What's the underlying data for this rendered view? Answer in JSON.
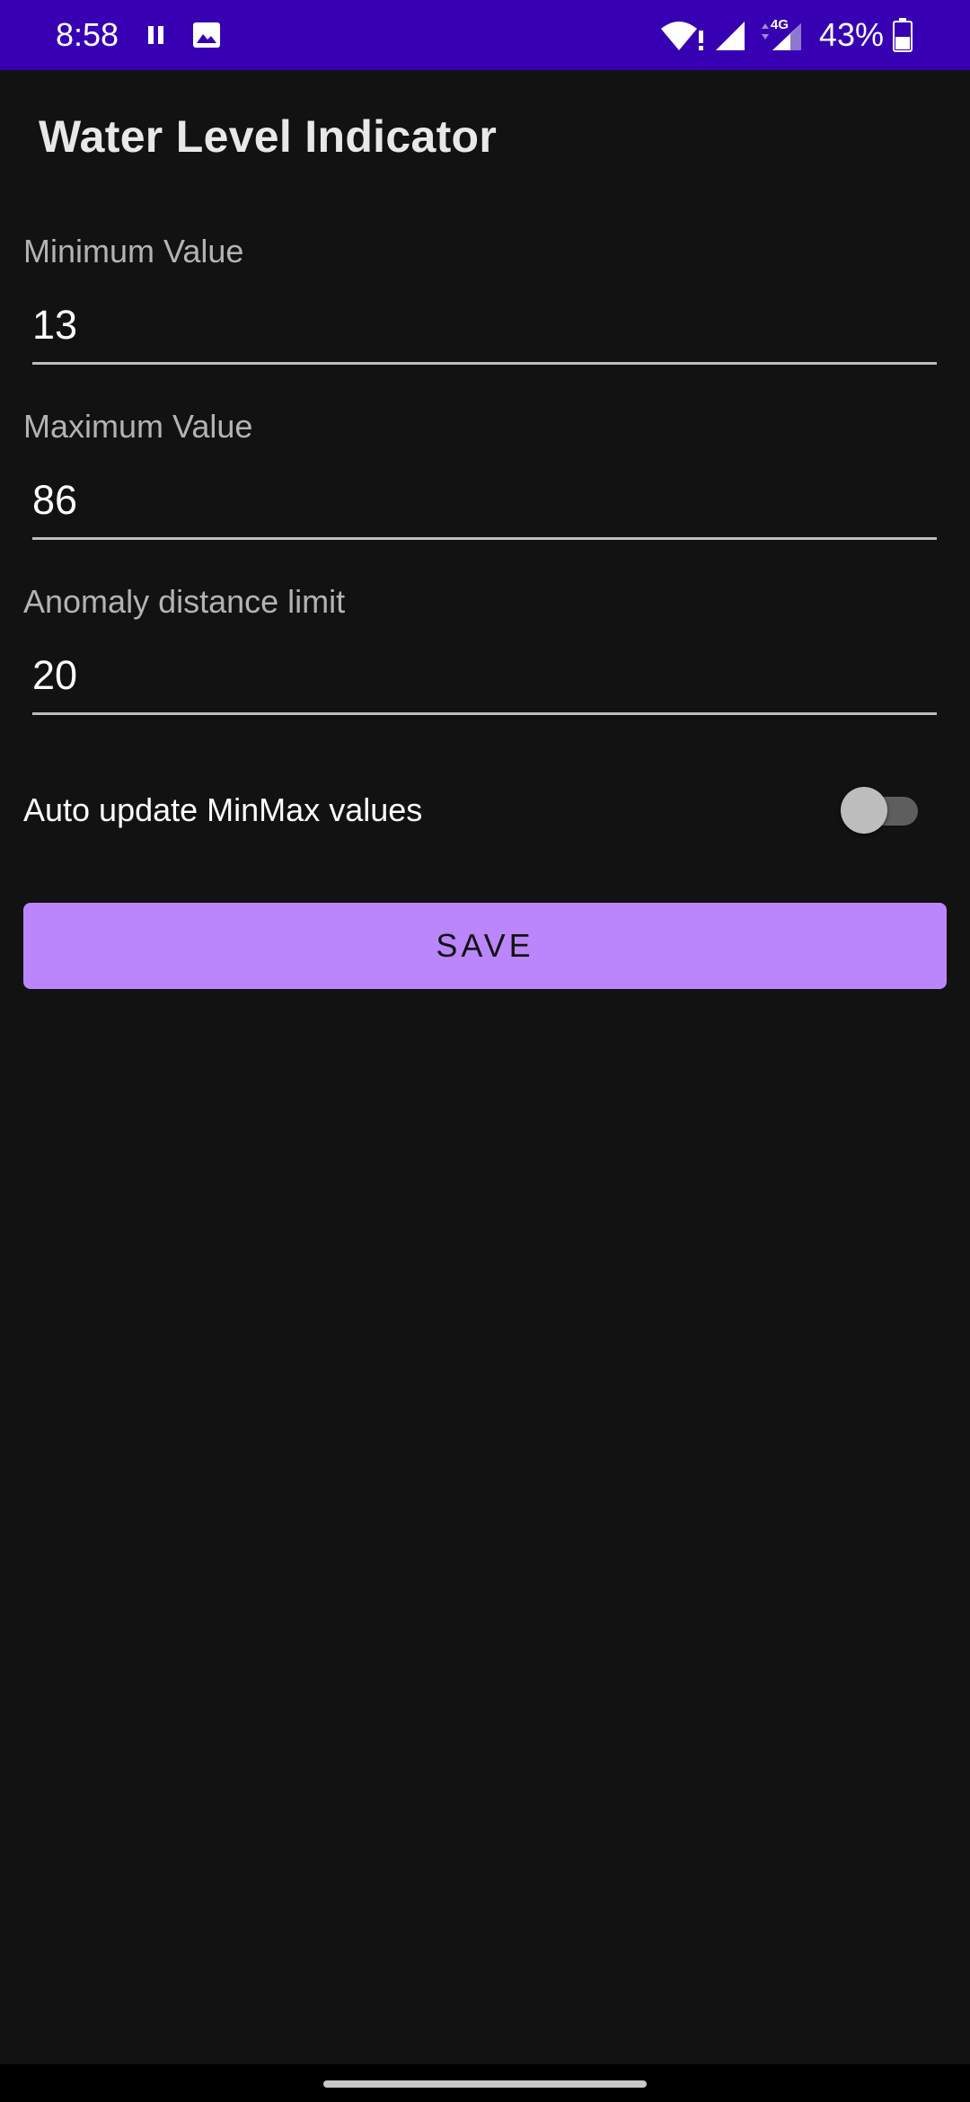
{
  "status_bar": {
    "time": "8:58",
    "battery_percent": "43%",
    "network_type": "4G",
    "icons": [
      "pause-icon",
      "image-icon",
      "wifi-alert-icon",
      "signal-icon",
      "signal-4g-icon",
      "battery-icon"
    ],
    "background_color": "#3700b3"
  },
  "toolbar": {
    "title": "Water Level Indicator"
  },
  "form": {
    "min_label": "Minimum Value",
    "min_value": "13",
    "max_label": "Maximum Value",
    "max_value": "86",
    "anomaly_label": "Anomaly distance limit",
    "anomaly_value": "20"
  },
  "auto_update": {
    "label": "Auto update MinMax values",
    "enabled": false
  },
  "save_button": {
    "label": "SAVE",
    "color": "#bb86fc"
  }
}
